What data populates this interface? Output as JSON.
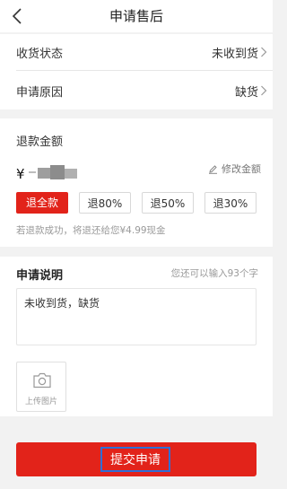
{
  "header": {
    "title": "申请售后",
    "back_icon": "chevron-left-icon"
  },
  "rows": {
    "receipt_status": {
      "label": "收货状态",
      "value": "未收到货"
    },
    "reason": {
      "label": "申请原因",
      "value": "缺货"
    }
  },
  "refund": {
    "title": "退款金额",
    "currency": "¥",
    "modify_label": "修改金额",
    "options": [
      "退全款",
      "退80%",
      "退50%",
      "退30%"
    ],
    "selected_index": 0,
    "note": "若退款成功，将退还给您¥4.99现金"
  },
  "explanation": {
    "title": "申请说明",
    "remaining_hint": "您还可以输入93个字",
    "text": "未收到货，缺货",
    "upload_label": "上传图片"
  },
  "submit": {
    "label": "提交申请"
  },
  "colors": {
    "accent": "#e2231a",
    "focus_outline": "#2f6fd6",
    "background": "#f2f2f2"
  }
}
